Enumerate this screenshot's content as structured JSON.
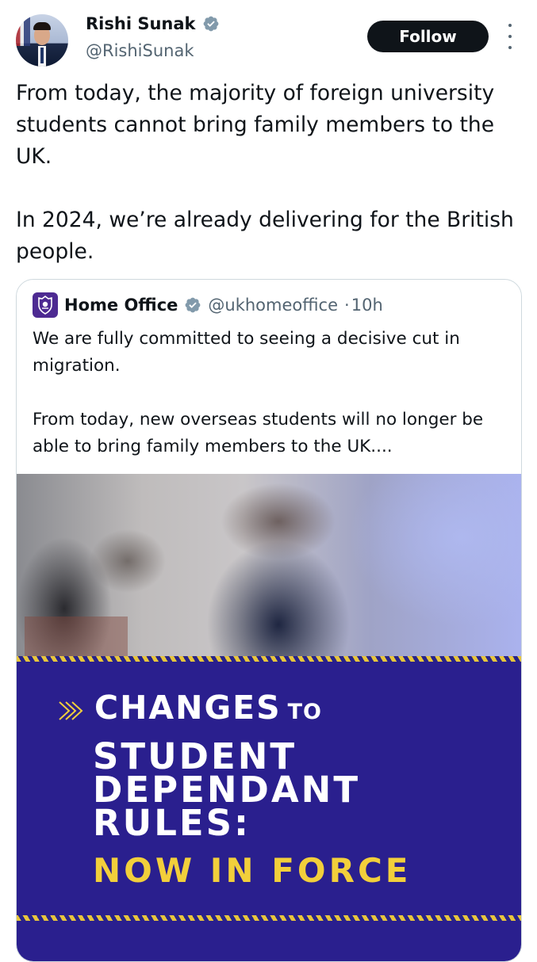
{
  "tweet": {
    "author": {
      "display_name": "Rishi Sunak",
      "handle": "@RishiSunak",
      "verified": true
    },
    "follow_label": "Follow",
    "paragraphs": [
      "From today, the majority of foreign university students cannot bring family members to the UK.",
      "In 2024, we’re already delivering for the British people."
    ]
  },
  "quote": {
    "author": {
      "display_name": "Home Office",
      "handle": "@ukhomeoffice",
      "separator": "·",
      "time": "10h",
      "verified": true
    },
    "paragraphs": [
      "We are fully committed to seeing a decisive cut in migration.",
      "From today, new overseas students will no longer be able to bring family members to the UK...."
    ],
    "media": {
      "headline_word_1": "CHANGES",
      "headline_word_2": "TO",
      "headline_line_2": "STUDENT",
      "headline_line_3": "DEPENDANT",
      "headline_line_4": "RULES:",
      "headline_line_5": "NOW IN FORCE"
    }
  },
  "colors": {
    "follow_bg": "#0f1419",
    "verified": "#829aab",
    "panel_blue": "#2a1f8e",
    "accent_yellow": "#f2cf3b"
  },
  "icons": {
    "verified": "verified-badge-icon",
    "more": "more-vertical-icon",
    "org": "home-office-crest-icon",
    "chevron": "double-chevron-icon"
  }
}
